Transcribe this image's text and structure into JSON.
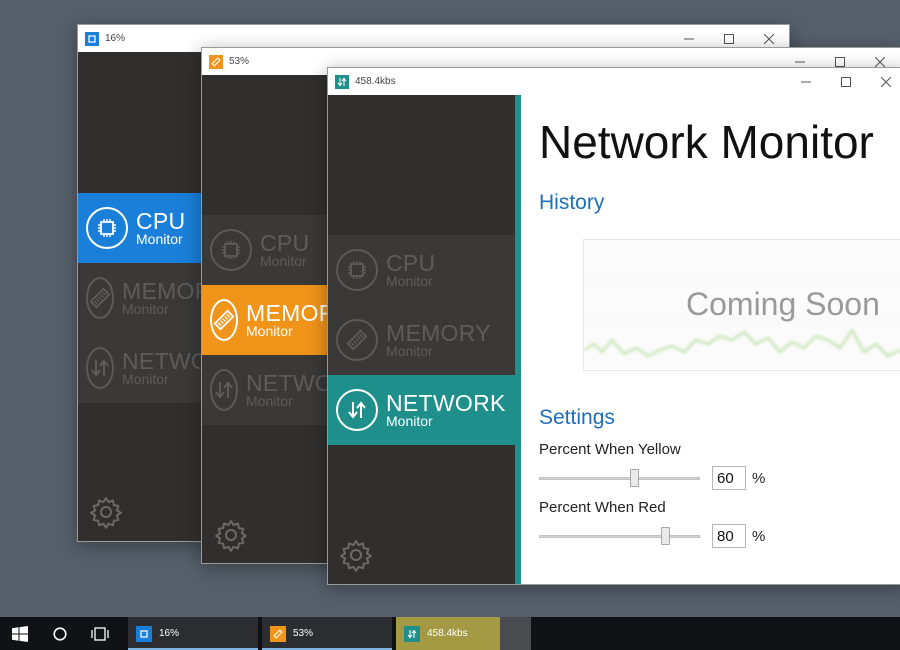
{
  "windows": {
    "cpu": {
      "title": "16%",
      "nav": [
        {
          "title": "CPU",
          "sub": "Monitor"
        },
        {
          "title": "MEMORY",
          "sub": "Monitor"
        },
        {
          "title": "NETWORK",
          "sub": "Monitor"
        }
      ],
      "accent": "#1a7fd9"
    },
    "memory": {
      "title": "53%",
      "nav": [
        {
          "title": "CPU",
          "sub": "Monitor"
        },
        {
          "title": "MEMORY",
          "sub": "Monitor"
        },
        {
          "title": "NETWORK",
          "sub": "Monitor"
        }
      ],
      "accent": "#f0941a"
    },
    "network": {
      "title": "458.4kbs",
      "nav": [
        {
          "title": "CPU",
          "sub": "Monitor"
        },
        {
          "title": "MEMORY",
          "sub": "Monitor"
        },
        {
          "title": "NETWORK",
          "sub": "Monitor"
        }
      ],
      "accent": "#1f8f8c",
      "page_title": "Network Monitor",
      "history": {
        "heading": "History",
        "placeholder": "Coming Soon"
      },
      "settings": {
        "heading": "Settings",
        "yellow": {
          "label": "Percent When Yellow",
          "value": "60",
          "unit": "%",
          "level": 0.6
        },
        "red": {
          "label": "Percent When Red",
          "value": "80",
          "unit": "%",
          "level": 0.8
        }
      }
    }
  },
  "taskbar": {
    "apps": [
      {
        "label": "16%",
        "icon": "cpu-chip-icon",
        "color": "#1a7fd9"
      },
      {
        "label": "53%",
        "icon": "memory-stick-icon",
        "color": "#f0941a"
      },
      {
        "label": "458.4kbs",
        "icon": "network-arrows-icon",
        "color": "#1f8f8c"
      }
    ]
  }
}
